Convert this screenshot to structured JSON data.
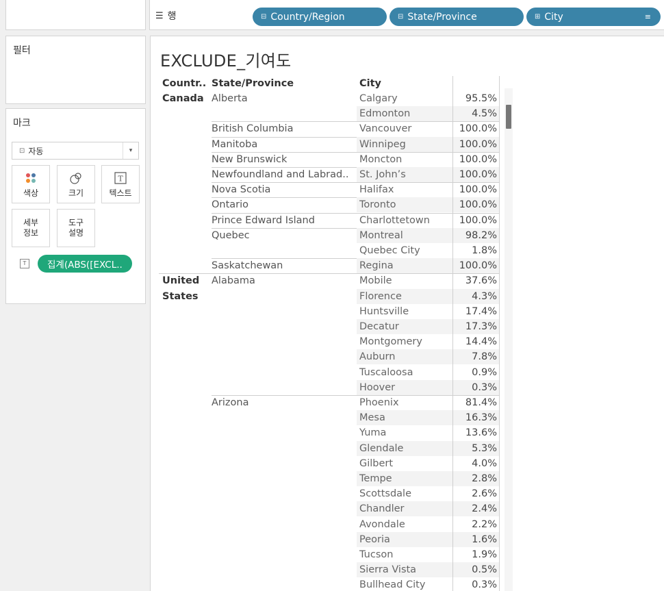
{
  "rows_shelf": {
    "label": "행",
    "pills": [
      "Country/Region",
      "State/Province",
      "City"
    ]
  },
  "filters": {
    "title": "필터"
  },
  "marks": {
    "title": "마크",
    "mark_type": "자동",
    "buttons": {
      "color": "색상",
      "size": "크기",
      "text": "텍스트",
      "detail_1": "세부",
      "detail_2": "정보",
      "tooltip_1": "도구",
      "tooltip_2": "설명"
    },
    "text_field": "집계(ABS([EXCL.."
  },
  "sheet": {
    "title": "EXCLUDE_기여도",
    "headers": {
      "country": "Countr..",
      "state": "State/Province",
      "city": "City"
    }
  },
  "colors": {
    "dimension_pill": "#3a84a8",
    "measure_pill": "#1fa77a"
  },
  "table": {
    "countries": [
      {
        "name_lines": [
          "Canada"
        ],
        "states": [
          {
            "name": "Alberta",
            "cities": [
              {
                "city": "Calgary",
                "value": "95.5%"
              },
              {
                "city": "Edmonton",
                "value": "4.5%"
              }
            ]
          },
          {
            "name": "British Columbia",
            "cities": [
              {
                "city": "Vancouver",
                "value": "100.0%"
              }
            ]
          },
          {
            "name": "Manitoba",
            "cities": [
              {
                "city": "Winnipeg",
                "value": "100.0%"
              }
            ]
          },
          {
            "name": "New Brunswick",
            "cities": [
              {
                "city": "Moncton",
                "value": "100.0%"
              }
            ]
          },
          {
            "name": "Newfoundland and Labrad..",
            "cities": [
              {
                "city": "St. John’s",
                "value": "100.0%"
              }
            ]
          },
          {
            "name": "Nova Scotia",
            "cities": [
              {
                "city": "Halifax",
                "value": "100.0%"
              }
            ]
          },
          {
            "name": "Ontario",
            "cities": [
              {
                "city": "Toronto",
                "value": "100.0%"
              }
            ]
          },
          {
            "name": "Prince Edward Island",
            "cities": [
              {
                "city": "Charlottetown",
                "value": "100.0%"
              }
            ]
          },
          {
            "name": "Quebec",
            "cities": [
              {
                "city": "Montreal",
                "value": "98.2%"
              },
              {
                "city": "Quebec City",
                "value": "1.8%"
              }
            ]
          },
          {
            "name": "Saskatchewan",
            "cities": [
              {
                "city": "Regina",
                "value": "100.0%"
              }
            ]
          }
        ]
      },
      {
        "name_lines": [
          "United",
          "States"
        ],
        "states": [
          {
            "name": "Alabama",
            "cities": [
              {
                "city": "Mobile",
                "value": "37.6%"
              },
              {
                "city": "Florence",
                "value": "4.3%"
              },
              {
                "city": "Huntsville",
                "value": "17.4%"
              },
              {
                "city": "Decatur",
                "value": "17.3%"
              },
              {
                "city": "Montgomery",
                "value": "14.4%"
              },
              {
                "city": "Auburn",
                "value": "7.8%"
              },
              {
                "city": "Tuscaloosa",
                "value": "0.9%"
              },
              {
                "city": "Hoover",
                "value": "0.3%"
              }
            ]
          },
          {
            "name": "Arizona",
            "cities": [
              {
                "city": "Phoenix",
                "value": "81.4%"
              },
              {
                "city": "Mesa",
                "value": "16.3%"
              },
              {
                "city": "Yuma",
                "value": "13.6%"
              },
              {
                "city": "Glendale",
                "value": "5.3%"
              },
              {
                "city": "Gilbert",
                "value": "4.0%"
              },
              {
                "city": "Tempe",
                "value": "2.8%"
              },
              {
                "city": "Scottsdale",
                "value": "2.6%"
              },
              {
                "city": "Chandler",
                "value": "2.4%"
              },
              {
                "city": "Avondale",
                "value": "2.2%"
              },
              {
                "city": "Peoria",
                "value": "1.6%"
              },
              {
                "city": "Tucson",
                "value": "1.9%"
              },
              {
                "city": "Sierra Vista",
                "value": "0.5%"
              },
              {
                "city": "Bullhead City",
                "value": "0.3%"
              }
            ]
          }
        ]
      }
    ]
  }
}
